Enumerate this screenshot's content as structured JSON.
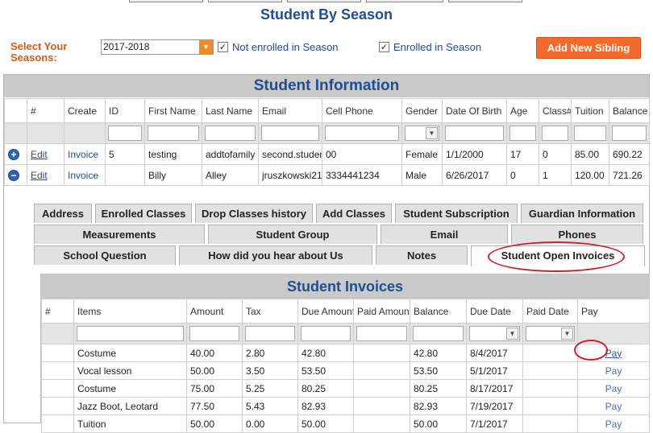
{
  "page_title": "Student By Season",
  "season_filter": {
    "label": "Select Your Seasons:",
    "selected": "2017-2018",
    "not_enrolled_label": "Not enrolled in Season",
    "not_enrolled_checked": "✓",
    "enrolled_label": "Enrolled in Season",
    "enrolled_checked": "✓",
    "add_sibling_label": "Add New Sibling"
  },
  "student_info": {
    "title": "Student Information",
    "columns": [
      "#",
      "Create",
      "ID",
      "First Name",
      "Last Name",
      "Email",
      "Cell Phone",
      "Gender",
      "Date Of Birth",
      "Age",
      "Class#",
      "Tuition",
      "Balance"
    ],
    "rows": [
      {
        "expander": "+",
        "edit": "Edit",
        "create": "Invoice",
        "id": "5",
        "first": "testing",
        "last": "addtofamily",
        "email": "second.student",
        "phone": "00",
        "gender": "Female",
        "dob": "1/1/2000",
        "age": "17",
        "classes": "0",
        "tuition": "85.00",
        "balance": "690.22"
      },
      {
        "expander": "−",
        "edit": "Edit",
        "create": "Invoice",
        "id": "",
        "first": "Billy",
        "last": "Alley",
        "email": "jruszkowski21",
        "phone": "3334441234",
        "gender": "Male",
        "dob": "6/26/2017",
        "age": "0",
        "classes": "1",
        "tuition": "120.00",
        "balance": "721.26"
      }
    ]
  },
  "tabs": {
    "row1": [
      "Address",
      "Enrolled Classes",
      "Drop Classes history",
      "Add Classes",
      "Student Subscription",
      "Guardian Information"
    ],
    "row2": [
      "Measurements",
      "Student Group",
      "Email",
      "Phones"
    ],
    "row3": [
      "School Question",
      "How did you hear about Us",
      "Notes",
      "Student Open Invoices"
    ]
  },
  "invoices": {
    "title": "Student Invoices",
    "columns": [
      "#",
      "Items",
      "Amount",
      "Tax",
      "Due Amount",
      "Paid Amount",
      "Balance",
      "Due Date",
      "Paid Date",
      "Pay"
    ],
    "rows": [
      {
        "item": "Costume",
        "amount": "40.00",
        "tax": "2.80",
        "due": "42.80",
        "paid": "",
        "balance": "42.80",
        "due_date": "8/4/2017",
        "paid_date": "",
        "pay": "Pay"
      },
      {
        "item": "Vocal lesson",
        "amount": "50.00",
        "tax": "3.50",
        "due": "53.50",
        "paid": "",
        "balance": "53.50",
        "due_date": "5/1/2017",
        "paid_date": "",
        "pay": "Pay"
      },
      {
        "item": "Costume",
        "amount": "75.00",
        "tax": "5.25",
        "due": "80.25",
        "paid": "",
        "balance": "80.25",
        "due_date": "8/17/2017",
        "paid_date": "",
        "pay": "Pay"
      },
      {
        "item": "Jazz Boot, Leotard",
        "amount": "77.50",
        "tax": "5.43",
        "due": "82.93",
        "paid": "",
        "balance": "82.93",
        "due_date": "7/19/2017",
        "paid_date": "",
        "pay": "Pay"
      },
      {
        "item": "Tuition",
        "amount": "50.00",
        "tax": "0.00",
        "due": "50.00",
        "paid": "",
        "balance": "50.00",
        "due_date": "7/1/2017",
        "paid_date": "",
        "pay": "Pay"
      }
    ]
  },
  "colors": {
    "brand_blue": "#1f4e91",
    "accent_orange": "#f26b2d",
    "highlight_red": "#d32028"
  }
}
